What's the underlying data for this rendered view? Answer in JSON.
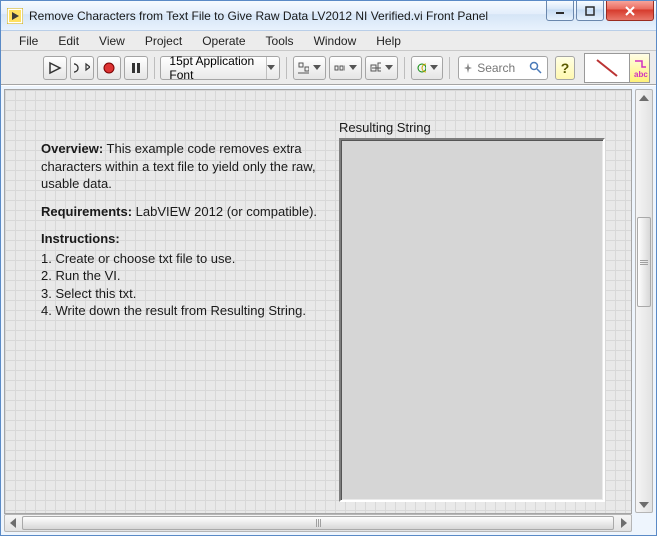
{
  "window": {
    "title": "Remove Characters from Text File to Give Raw Data LV2012 NI Verified.vi Front Panel"
  },
  "menu": {
    "file": "File",
    "edit": "Edit",
    "view": "View",
    "project": "Project",
    "operate": "Operate",
    "tools": "Tools",
    "window": "Window",
    "help": "Help"
  },
  "toolbar": {
    "font_label": "15pt Application Font",
    "search_placeholder": "Search",
    "help_label": "?"
  },
  "info": {
    "overview_label": "Overview:",
    "overview_text": " This example code removes extra characters within a text file to yield only the raw, usable data.",
    "requirements_label": "Requirements:",
    "requirements_text": " LabVIEW 2012 (or compatible).",
    "instructions_label": "Instructions:",
    "step1": "1. Create or choose txt file to use.",
    "step2": "2. Run the VI.",
    "step3": "3. Select this txt.",
    "step4": "4. Write down the result from Resulting String."
  },
  "result": {
    "label": "Resulting String",
    "value": ""
  }
}
